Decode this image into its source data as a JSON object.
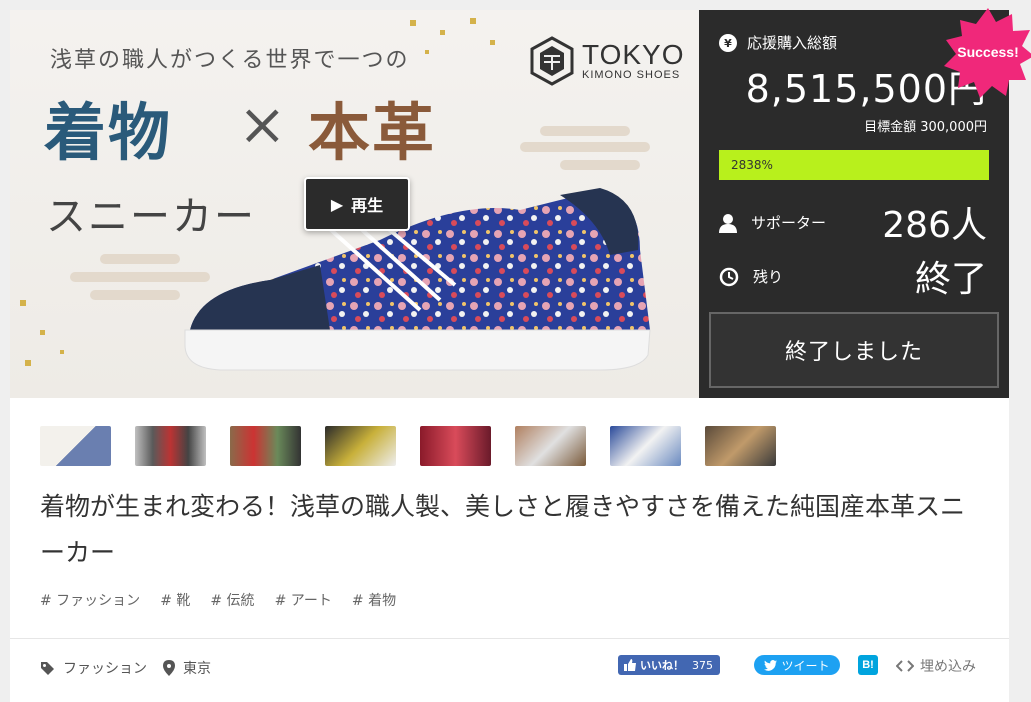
{
  "hero": {
    "subtitle": "浅草の職人がつくる世界で一つの",
    "headline_kimono": "着物",
    "headline_cross": "×",
    "headline_leather": "本革",
    "headline_sneaker": "スニーカー",
    "logo_main": "TOKYO",
    "logo_sub": "KIMONO SHOES",
    "play_icon": "▶",
    "play_label": "再生"
  },
  "panel": {
    "yen_icon": "yen-icon",
    "total_label": "応援購入総額",
    "total_value": "8,515,500円",
    "target": "目標金額 300,000円",
    "progress_percent": 2838,
    "progress_label": "2838%",
    "supporters_label": "サポーター",
    "supporters_value": "286人",
    "remaining_label": "残り",
    "remaining_value": "終了",
    "ended_button": "終了しました",
    "success_badge": "Success!",
    "accent_color": "#b8f01c",
    "badge_color": "#f0287a"
  },
  "project": {
    "title": "着物が生まれ変わる！浅草の職人製、美しさと履きやすさを備えた純国産本革スニーカー",
    "tags": [
      "# ファッション",
      "# 靴",
      "# 伝統",
      "# アート",
      "# 着物"
    ]
  },
  "footer": {
    "category": "ファッション",
    "location": "東京",
    "fb_label": "いいね！",
    "fb_count": "375",
    "tweet_label": "ツイート",
    "hatena_label": "B!",
    "embed_label": "埋め込み"
  }
}
